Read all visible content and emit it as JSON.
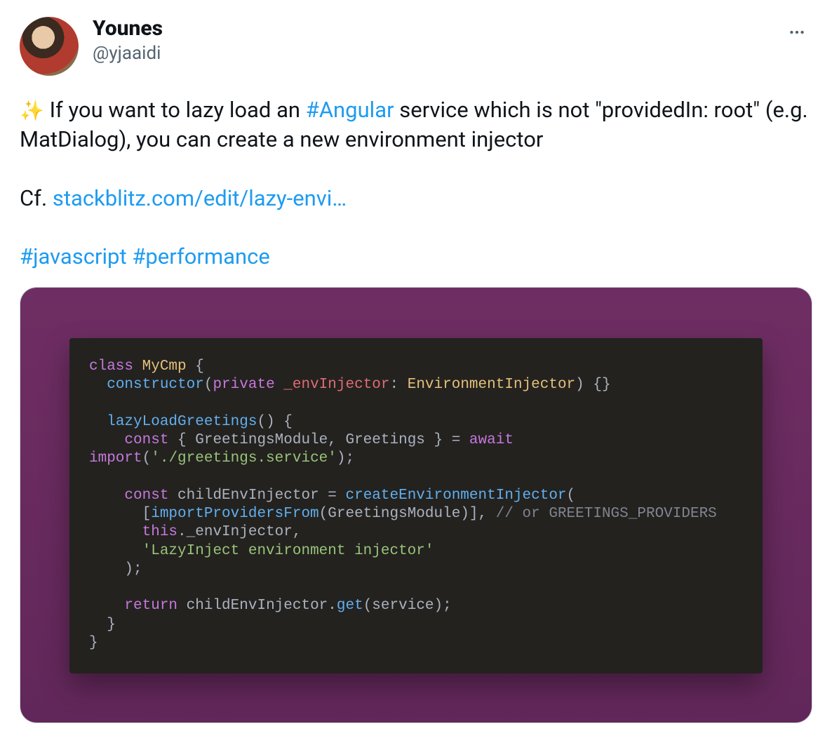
{
  "user": {
    "display_name": "Younes",
    "handle": "@yjaaidi"
  },
  "tweet": {
    "emoji": "✨",
    "line1_pre": " If you want to lazy load an ",
    "hashtag_angular": "#Angular",
    "line1_post": " service which is not \"providedIn: root\" (e.g. MatDialog), you can create a new environment injector",
    "cf_prefix": "Cf. ",
    "link_text": "stackblitz.com/edit/lazy-envi…",
    "hashtag_js": "#javascript",
    "hashtag_perf": "#performance"
  },
  "code": {
    "l01_kw_class": "class",
    "l01_name": " MyCmp ",
    "l01_brace": "{",
    "l02_indent": "  ",
    "l02_ctor": "constructor",
    "l02_open": "(",
    "l02_private": "private",
    "l02_var": " _envInjector",
    "l02_colon": ": ",
    "l02_type": "EnvironmentInjector",
    "l02_close": ") {}",
    "l04_indent": "  ",
    "l04_fn": "lazyLoadGreetings",
    "l04_rest": "() {",
    "l05_indent": "    ",
    "l05_const": "const",
    "l05_mid": " { GreetingsModule, Greetings } = ",
    "l05_await": "await",
    "l06_pre": "",
    "l06_import": "import",
    "l06_open": "(",
    "l06_str": "'./greetings.service'",
    "l06_close": ");",
    "l08_indent": "    ",
    "l08_const": "const",
    "l08_mid": " childEnvInjector = ",
    "l08_fn": "createEnvironmentInjector",
    "l08_open": "(",
    "l09_indent": "      [",
    "l09_fn": "importProvidersFrom",
    "l09_open": "(",
    "l09_arg": "GreetingsModule",
    "l09_close": ")], ",
    "l09_comment": "// or GREETINGS_PROVIDERS",
    "l10_indent": "      ",
    "l10_this": "this",
    "l10_rest": "._envInjector,",
    "l11_indent": "      ",
    "l11_str": "'LazyInject environment injector'",
    "l12": "    );",
    "l14_indent": "    ",
    "l14_return": "return",
    "l14_mid": " childEnvInjector.",
    "l14_fn": "get",
    "l14_rest": "(service);",
    "l15": "  }",
    "l16": "}"
  }
}
